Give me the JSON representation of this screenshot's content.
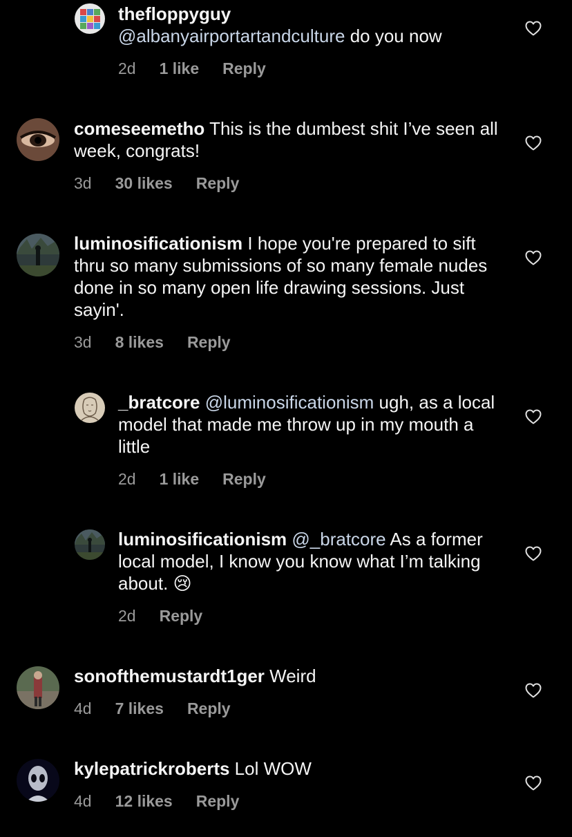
{
  "comments": [
    {
      "username": "thefloppyguy",
      "mention": "@albanyairportartandculture",
      "text": " do you now",
      "time": "2d",
      "likes": "1 like",
      "reply": "Reply",
      "avatar_icon": "grid-color-avatar"
    },
    {
      "username": "comeseemetho",
      "text": " This is the dumbest shit I’ve seen all week, congrats!",
      "time": "3d",
      "likes": "30 likes",
      "reply": "Reply",
      "avatar_icon": "eye-avatar"
    },
    {
      "username": "luminosificationism",
      "text": " I hope you're prepared to sift thru so many submissions of so many female nudes done in so many open life drawing sessions. Just sayin'.",
      "time": "3d",
      "likes": "8 likes",
      "reply": "Reply",
      "avatar_icon": "figure-avatar"
    },
    {
      "username": "_bratcore",
      "mention": "@luminosificationism",
      "text": " ugh, as a local model that made me throw up in my mouth a little",
      "time": "2d",
      "likes": "1 like",
      "reply": "Reply",
      "avatar_icon": "sketch-avatar"
    },
    {
      "username": "luminosificationism",
      "mention": "@_bratcore",
      "text": " As a former local model, I know you know what I’m talking about. ",
      "emoji": "😢",
      "time": "2d",
      "reply": "Reply",
      "avatar_icon": "figure-avatar"
    },
    {
      "username": "sonofthemustardt1ger",
      "text": " Weird",
      "time": "4d",
      "likes": "7 likes",
      "reply": "Reply",
      "avatar_icon": "person-avatar"
    },
    {
      "username": "kylepatrickroberts",
      "text": " Lol WOW",
      "time": "4d",
      "likes": "12 likes",
      "reply": "Reply",
      "avatar_icon": "alien-avatar"
    }
  ],
  "colors": {
    "background": "#000000",
    "text": "#f5f5f5",
    "meta": "#9a9a9a",
    "heart": "#e0e0e0"
  },
  "icons": {
    "like": "heart-outline-icon"
  }
}
